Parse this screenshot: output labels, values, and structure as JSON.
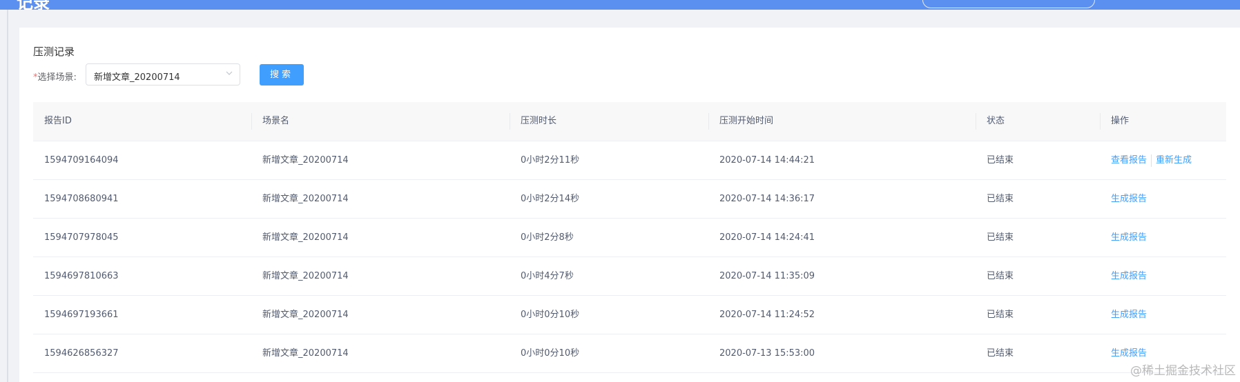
{
  "topbar": {
    "logo_text": "记录"
  },
  "card": {
    "title": "压测记录",
    "filter": {
      "required_mark": "*",
      "label": "选择场景:",
      "selected_value": "新增文章_20200714",
      "search_label": "搜索"
    }
  },
  "table": {
    "columns": [
      "报告ID",
      "场景名",
      "压测时长",
      "压测开始时间",
      "状态",
      "操作"
    ],
    "rows": [
      {
        "id": "1594709164094",
        "scene": "新增文章_20200714",
        "duration": "0小时2分11秒",
        "start": "2020-07-14 14:44:21",
        "status": "已结束",
        "actions": [
          "查看报告",
          "重新生成"
        ]
      },
      {
        "id": "1594708680941",
        "scene": "新增文章_20200714",
        "duration": "0小时2分14秒",
        "start": "2020-07-14 14:36:17",
        "status": "已结束",
        "actions": [
          "生成报告"
        ]
      },
      {
        "id": "1594707978045",
        "scene": "新增文章_20200714",
        "duration": "0小时2分8秒",
        "start": "2020-07-14 14:24:41",
        "status": "已结束",
        "actions": [
          "生成报告"
        ]
      },
      {
        "id": "1594697810663",
        "scene": "新增文章_20200714",
        "duration": "0小时4分7秒",
        "start": "2020-07-14 11:35:09",
        "status": "已结束",
        "actions": [
          "生成报告"
        ]
      },
      {
        "id": "1594697193661",
        "scene": "新增文章_20200714",
        "duration": "0小时0分10秒",
        "start": "2020-07-14 11:24:52",
        "status": "已结束",
        "actions": [
          "生成报告"
        ]
      },
      {
        "id": "1594626856327",
        "scene": "新增文章_20200714",
        "duration": "0小时0分10秒",
        "start": "2020-07-13 15:53:00",
        "status": "已结束",
        "actions": [
          "生成报告"
        ]
      }
    ]
  },
  "watermark": "@稀土掘金技术社区",
  "colors": {
    "topbar": "#5b8ff0",
    "primary": "#409eff",
    "required": "#f56c6c"
  }
}
